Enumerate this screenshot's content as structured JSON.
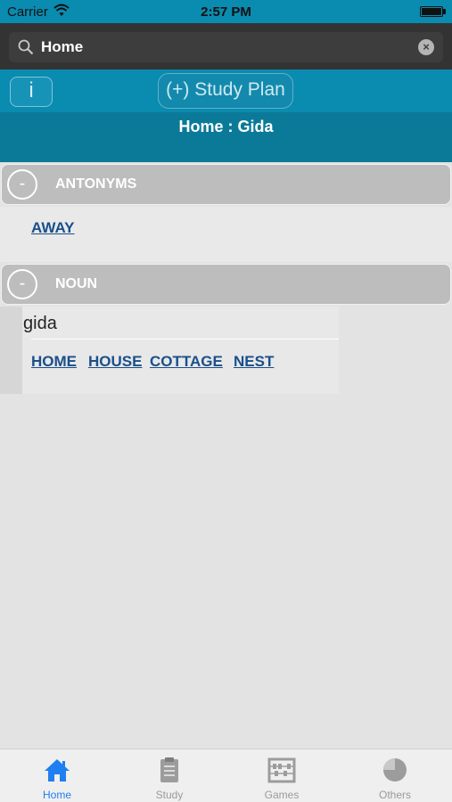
{
  "status_bar": {
    "carrier": "Carrier",
    "time": "2:57 PM"
  },
  "search": {
    "value": "Home",
    "clear_glyph": "×"
  },
  "toolbar": {
    "info_label": "i",
    "study_plan_label": "(+) Study Plan"
  },
  "title": "Home : Gida",
  "sections": {
    "antonyms": {
      "collapse_glyph": "-",
      "label": "ANTONYMS",
      "words": [
        "AWAY"
      ]
    },
    "noun": {
      "collapse_glyph": "-",
      "label": "NOUN",
      "term": "gida",
      "synonyms": [
        "HOME",
        "HOUSE",
        "COTTAGE",
        "NEST"
      ]
    }
  },
  "tabs": [
    {
      "label": "Home",
      "icon": "home-icon",
      "active": true
    },
    {
      "label": "Study",
      "icon": "clipboard-icon",
      "active": false
    },
    {
      "label": "Games",
      "icon": "abacus-icon",
      "active": false
    },
    {
      "label": "Others",
      "icon": "pie-icon",
      "active": false
    }
  ],
  "colors": {
    "accent": "#0a8bb0",
    "title_bar": "#0b7a99",
    "link": "#1a4f8a",
    "active_tab": "#1f7ff0"
  }
}
